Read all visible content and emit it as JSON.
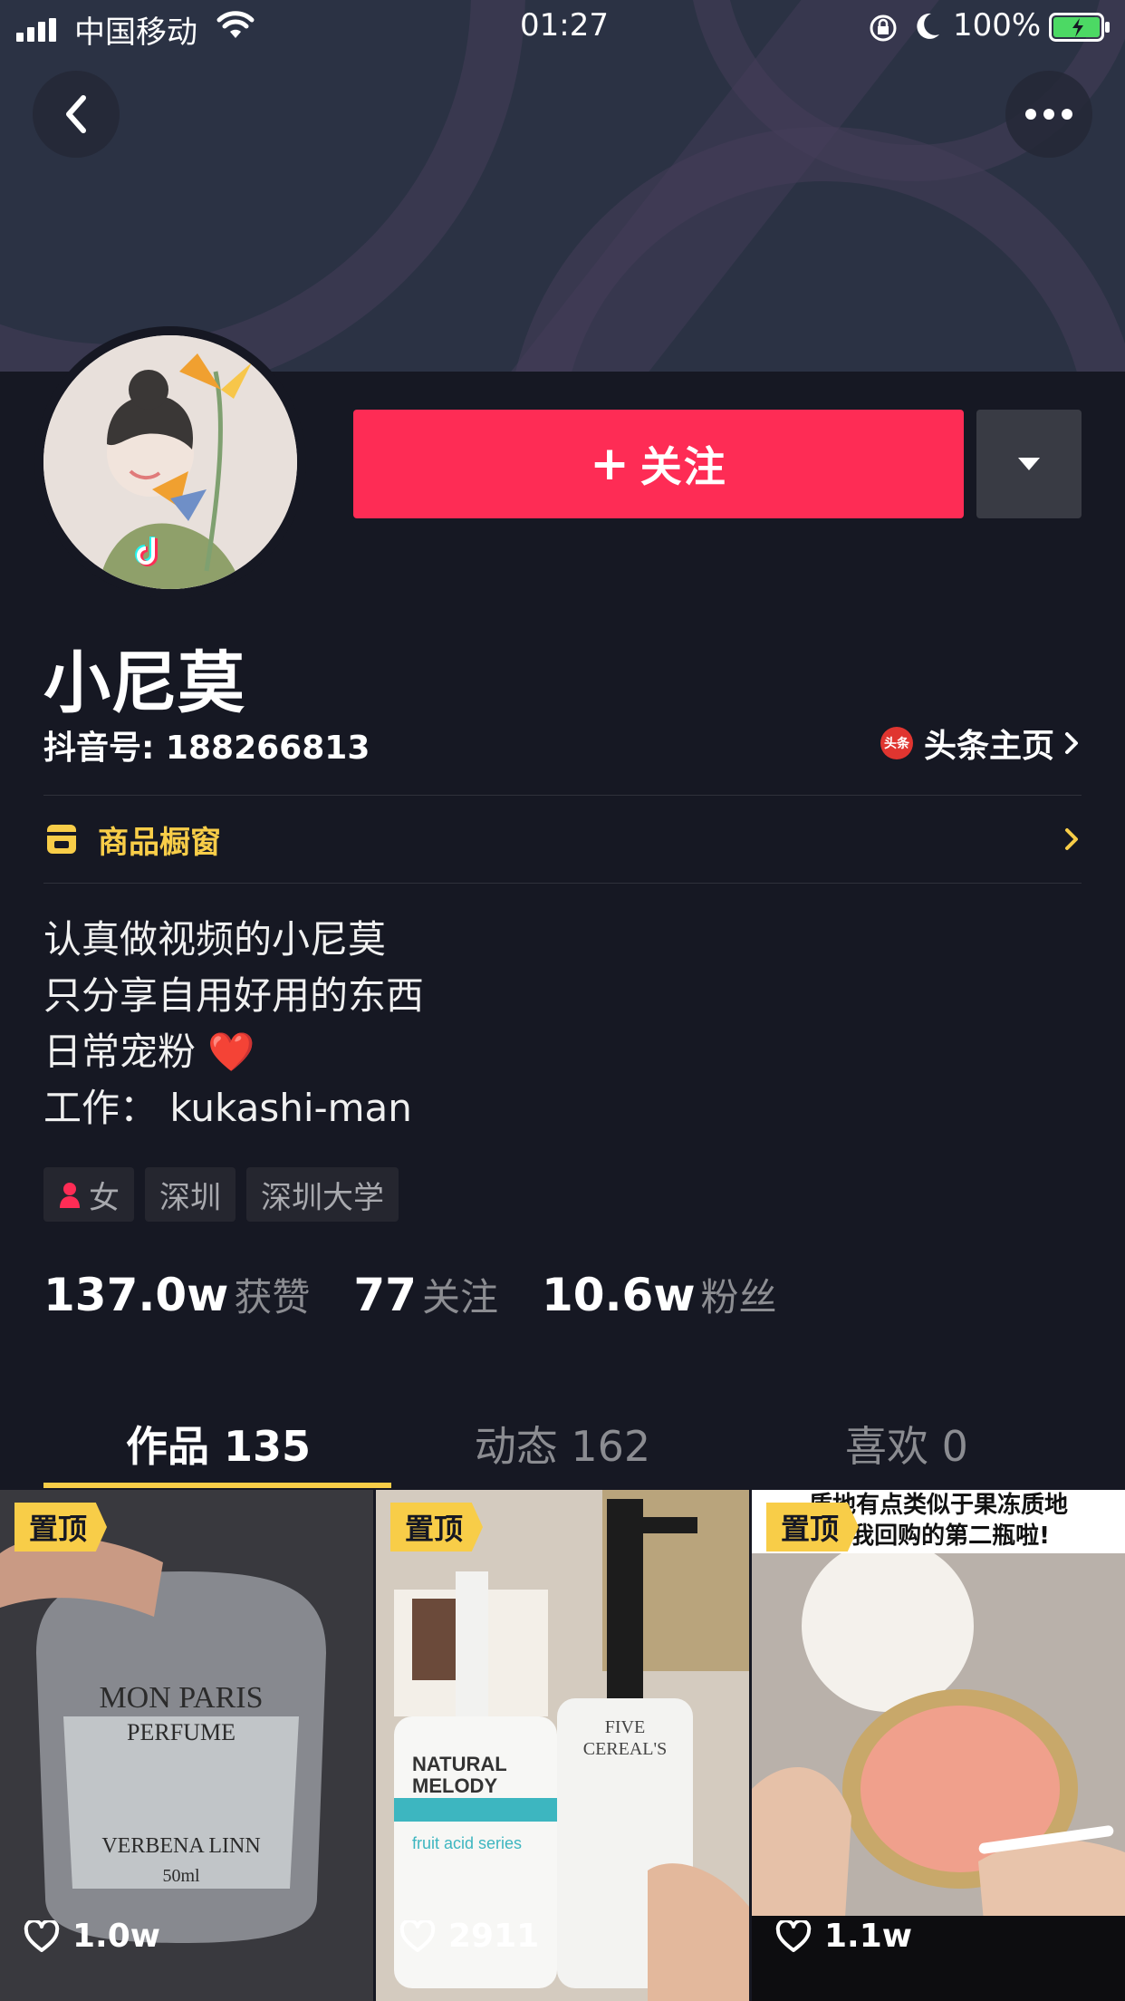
{
  "status_bar": {
    "carrier": "中国移动",
    "time": "01:27",
    "battery": "100%"
  },
  "actions": {
    "follow_label": "关注",
    "follow_plus": "+"
  },
  "profile": {
    "name": "小尼莫",
    "douyin_id": "抖音号: 188266813",
    "toutiao_logo": "头条",
    "toutiao_link": "头条主页",
    "shop_window": "商品橱窗",
    "bio": [
      "认真做视频的小尼莫",
      "只分享自用好用的东西",
      "日常宠粉 ❤️",
      "工作：  kukashi-man"
    ],
    "tags": [
      "女",
      "深圳",
      "深圳大学"
    ],
    "stats": [
      {
        "num": "137.0w",
        "label": "获赞"
      },
      {
        "num": "77",
        "label": "关注"
      },
      {
        "num": "10.6w",
        "label": "粉丝"
      }
    ]
  },
  "tabs": [
    {
      "label": "作品 135",
      "active": true
    },
    {
      "label": "动态 162",
      "active": false
    },
    {
      "label": "喜欢 0",
      "active": false
    }
  ],
  "videos": [
    {
      "pinned_label": "置顶",
      "likes": "1.0w",
      "overlay": [
        "MON PARIS",
        "PERFUME",
        "VERBENA LINN",
        "50ml"
      ]
    },
    {
      "pinned_label": "置顶",
      "likes": "2911",
      "overlay": [
        "NATURAL",
        "MELODY",
        "fruit acid series",
        "FIVE",
        "CEREAL'S"
      ]
    },
    {
      "pinned_label": "置顶",
      "likes": "1.1w",
      "caption": [
        "质地有点类似于果冻质地",
        "是我回购的第二瓶啦!"
      ]
    }
  ],
  "colors": {
    "background": "#161823",
    "follow_red": "#fe2c55",
    "accent_yellow": "#f8cd48",
    "banner": "#2b3244"
  }
}
